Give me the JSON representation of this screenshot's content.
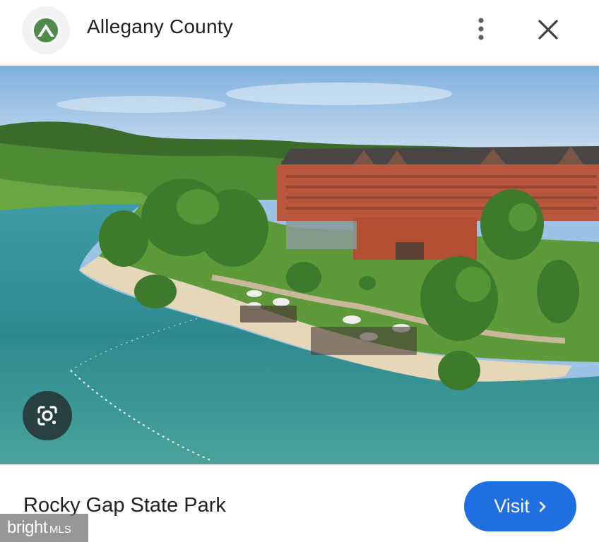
{
  "header": {
    "site_title": "Allegany County",
    "logo_icon": "mountain-logo-icon",
    "more_icon": "more-vert-icon",
    "close_icon": "close-icon"
  },
  "image": {
    "lens_icon": "google-lens-icon"
  },
  "footer": {
    "caption": "Rocky Gap State Park",
    "visit_label": "Visit",
    "visit_icon": "chevron-right-icon"
  },
  "watermark": {
    "brand": "bright",
    "suffix": "MLS"
  },
  "colors": {
    "accent": "#1f6fe0",
    "logo_green": "#4f8a4a"
  }
}
